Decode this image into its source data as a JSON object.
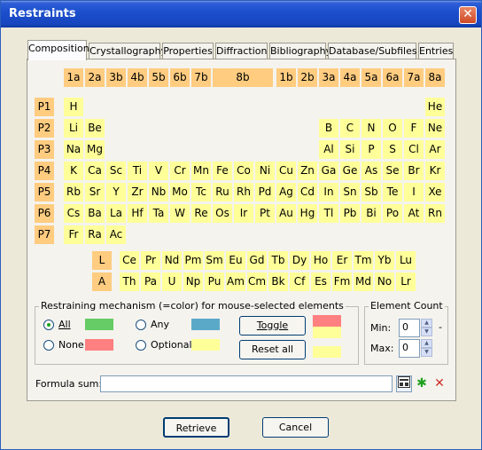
{
  "window": {
    "title": "Restraints",
    "close_glyph": "✕"
  },
  "tabs": [
    "Composition",
    "Crystallography",
    "Properties",
    "Diffraction",
    "Bibliography",
    "Database/Subfiles",
    "Entries"
  ],
  "groups": [
    "1a",
    "2a",
    "3b",
    "4b",
    "5b",
    "6b",
    "7b",
    "8b",
    "1b",
    "2b",
    "3a",
    "4a",
    "5a",
    "6a",
    "7a",
    "8a"
  ],
  "periods": [
    "P1",
    "P2",
    "P3",
    "P4",
    "P5",
    "P6",
    "P7"
  ],
  "elements": {
    "P1": [
      "H",
      "He"
    ],
    "P2": [
      "Li",
      "Be",
      "B",
      "C",
      "N",
      "O",
      "F",
      "Ne"
    ],
    "P3": [
      "Na",
      "Mg",
      "Al",
      "Si",
      "P",
      "S",
      "Cl",
      "Ar"
    ],
    "P4": [
      "K",
      "Ca",
      "Sc",
      "Ti",
      "V",
      "Cr",
      "Mn",
      "Fe",
      "Co",
      "Ni",
      "Cu",
      "Zn",
      "Ga",
      "Ge",
      "As",
      "Se",
      "Br",
      "Kr"
    ],
    "P5": [
      "Rb",
      "Sr",
      "Y",
      "Zr",
      "Nb",
      "Mo",
      "Tc",
      "Ru",
      "Rh",
      "Pd",
      "Ag",
      "Cd",
      "In",
      "Sn",
      "Sb",
      "Te",
      "I",
      "Xe"
    ],
    "P6": [
      "Cs",
      "Ba",
      "La",
      "Hf",
      "Ta",
      "W",
      "Re",
      "Os",
      "Ir",
      "Pt",
      "Au",
      "Hg",
      "Tl",
      "Pb",
      "Bi",
      "Po",
      "At",
      "Rn"
    ],
    "P7": [
      "Fr",
      "Ra",
      "Ac"
    ]
  },
  "series": [
    {
      "label": "L",
      "elements": [
        "Ce",
        "Pr",
        "Nd",
        "Pm",
        "Sm",
        "Eu",
        "Gd",
        "Tb",
        "Dy",
        "Ho",
        "Er",
        "Tm",
        "Yb",
        "Lu"
      ]
    },
    {
      "label": "A",
      "elements": [
        "Th",
        "Pa",
        "U",
        "Np",
        "Pu",
        "Am",
        "Cm",
        "Bk",
        "Cf",
        "Es",
        "Fm",
        "Md",
        "No",
        "Lr"
      ]
    }
  ],
  "mechanism": {
    "title": "Restraining mechanism (=color) for mouse-selected elements",
    "all": "All",
    "none": "None",
    "any": "Any",
    "optional": "Optional",
    "toggle": "Toggle",
    "reset": "Reset all",
    "colors": {
      "all": "#66cc66",
      "none": "#ff8080",
      "any": "#5ba9c9",
      "optional": "#ffff99"
    }
  },
  "element_count": {
    "title": "Element Count",
    "min_label": "Min:",
    "max_label": "Max:",
    "min_value": "0",
    "max_value": "0",
    "dash": "-"
  },
  "formula": {
    "label": "Formula sum:",
    "value": ""
  },
  "buttons": {
    "retrieve": "Retrieve",
    "cancel": "Cancel"
  },
  "colors": {
    "element_yellow": "#ffff99",
    "header_orange": "#ffcc80",
    "accent_green": "#21a121",
    "accent_red": "#d0302a"
  }
}
